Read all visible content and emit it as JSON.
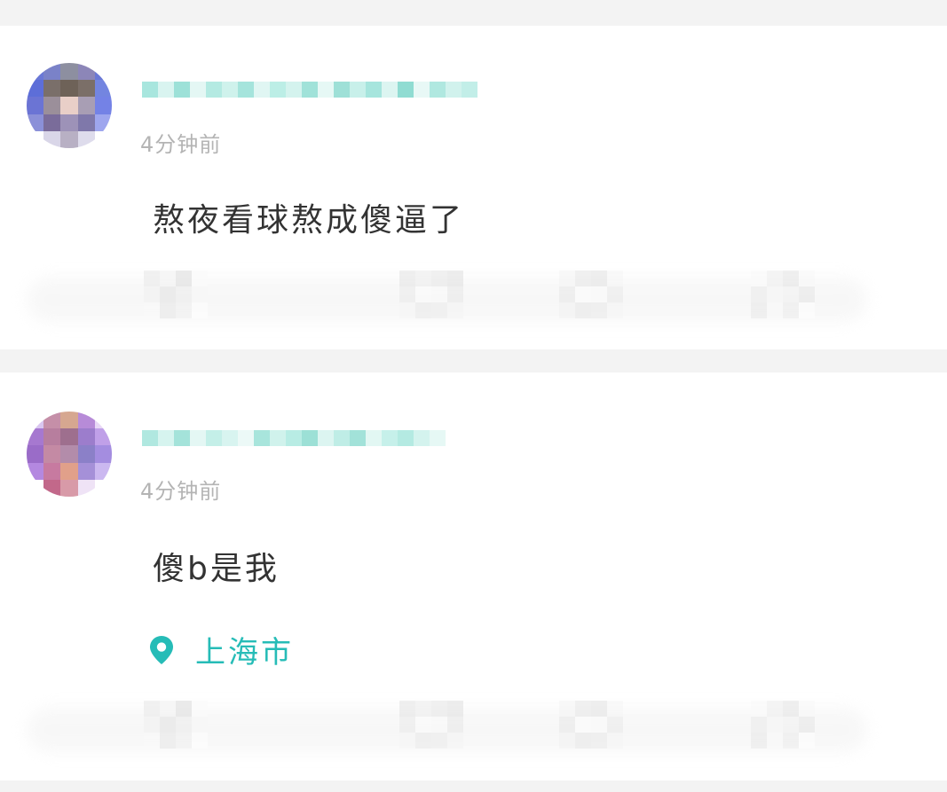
{
  "posts": [
    {
      "timestamp": "4分钟前",
      "content": "熬夜看球熬成傻逼了",
      "location": ""
    },
    {
      "timestamp": "4分钟前",
      "content": "傻b是我",
      "location": "上海市"
    }
  ],
  "colors": {
    "accent": "#26bcb7",
    "timestamp": "#b4b4b4",
    "content": "#333333",
    "background": "#f3f3f3",
    "card": "#ffffff"
  },
  "icons": {
    "location": "map-pin-icon"
  }
}
